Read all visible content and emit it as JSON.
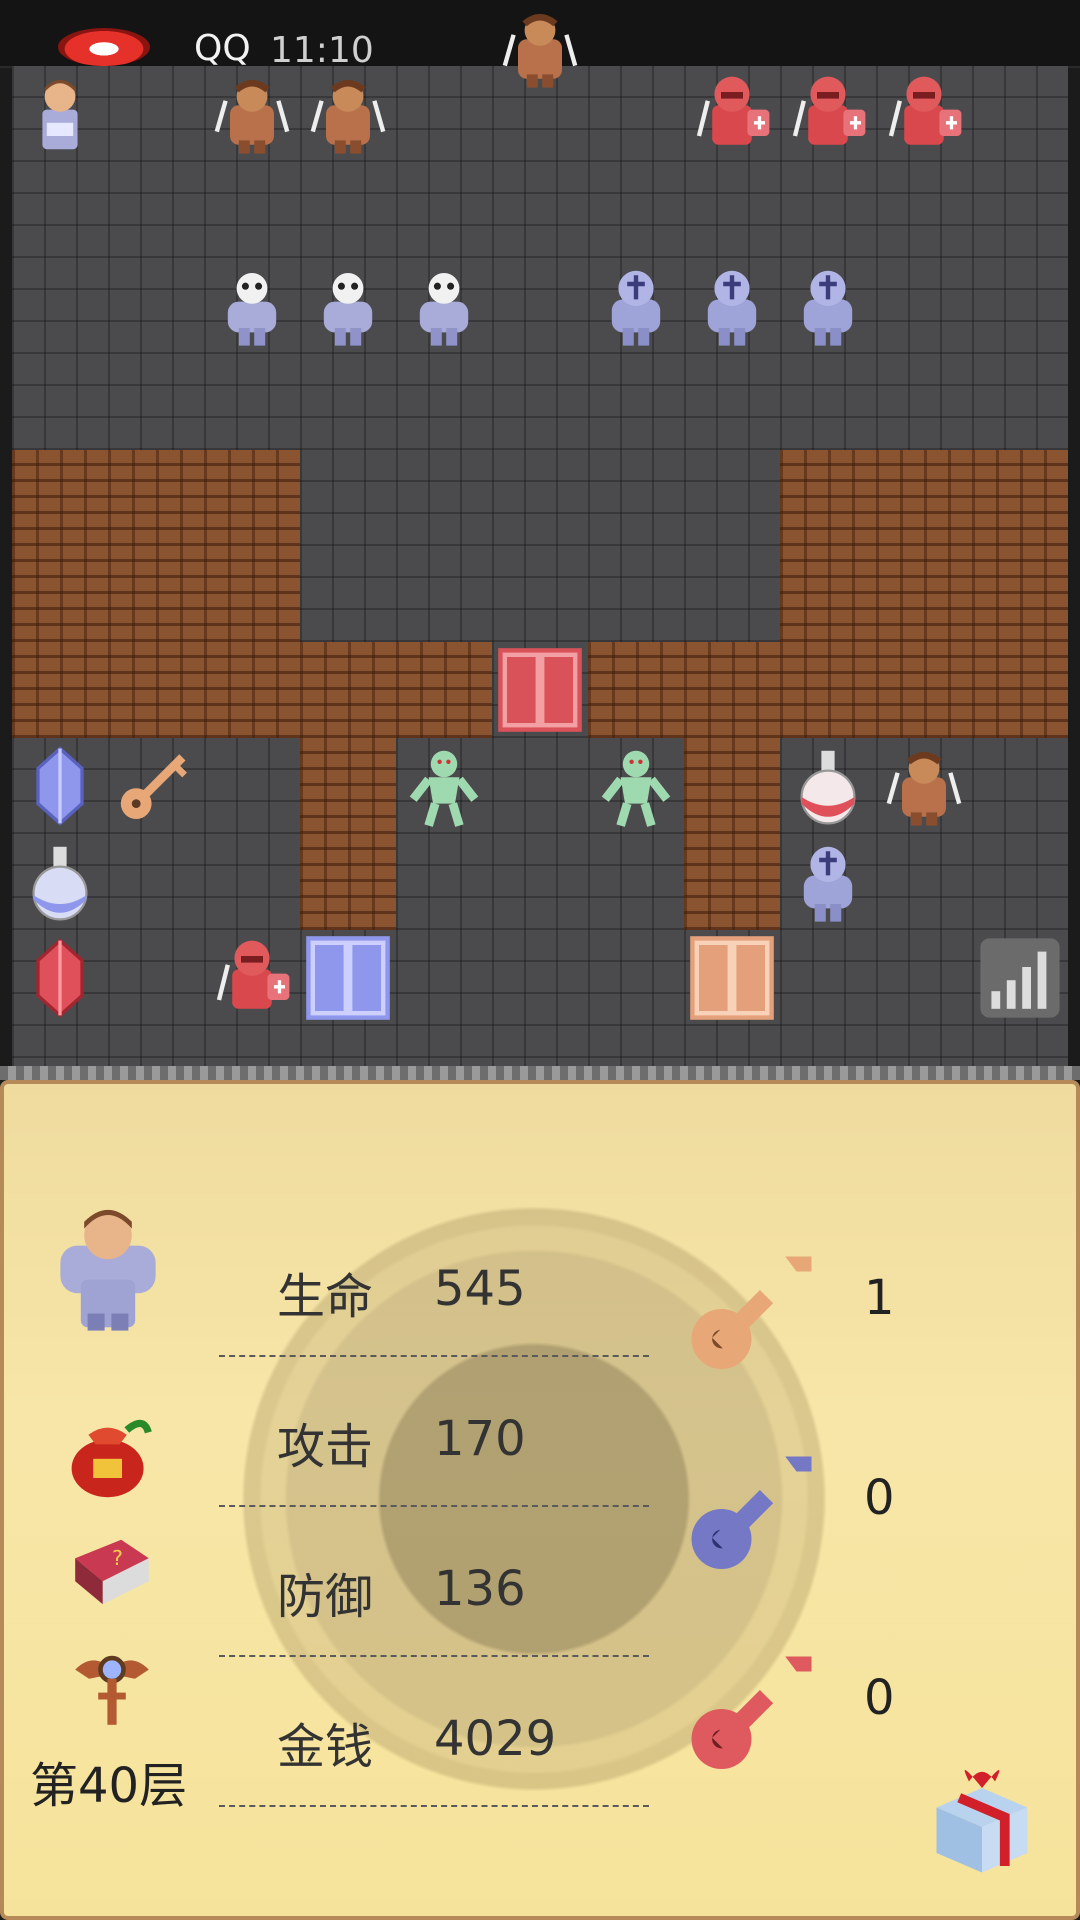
{
  "status_bar": {
    "app_name": "QQ",
    "time": "11:10"
  },
  "board": {
    "grid": "11x11 tiles",
    "top_row_partial_sprite": "barbarian",
    "tiles": {
      "walls": "brown brick",
      "floor": "grey stone"
    }
  },
  "stats": {
    "hp_label": "生命",
    "hp_value": "545",
    "atk_label": "攻击",
    "atk_value": "170",
    "def_label": "防御",
    "def_value": "136",
    "gold_label": "金钱",
    "gold_value": "4029"
  },
  "keys": {
    "yellow": "1",
    "blue": "0",
    "red": "0"
  },
  "floor_label": "第40层",
  "icons": {
    "hero": "hero-icon",
    "bag": "item-bag-icon",
    "book": "monster-book-icon",
    "wand": "fly-wand-icon",
    "gift": "gift-box-icon",
    "signal": "signal-icon"
  },
  "colors": {
    "panel_bg": "#f6e39b",
    "wall": "#8a5430",
    "floor": "#4b4b4d"
  }
}
